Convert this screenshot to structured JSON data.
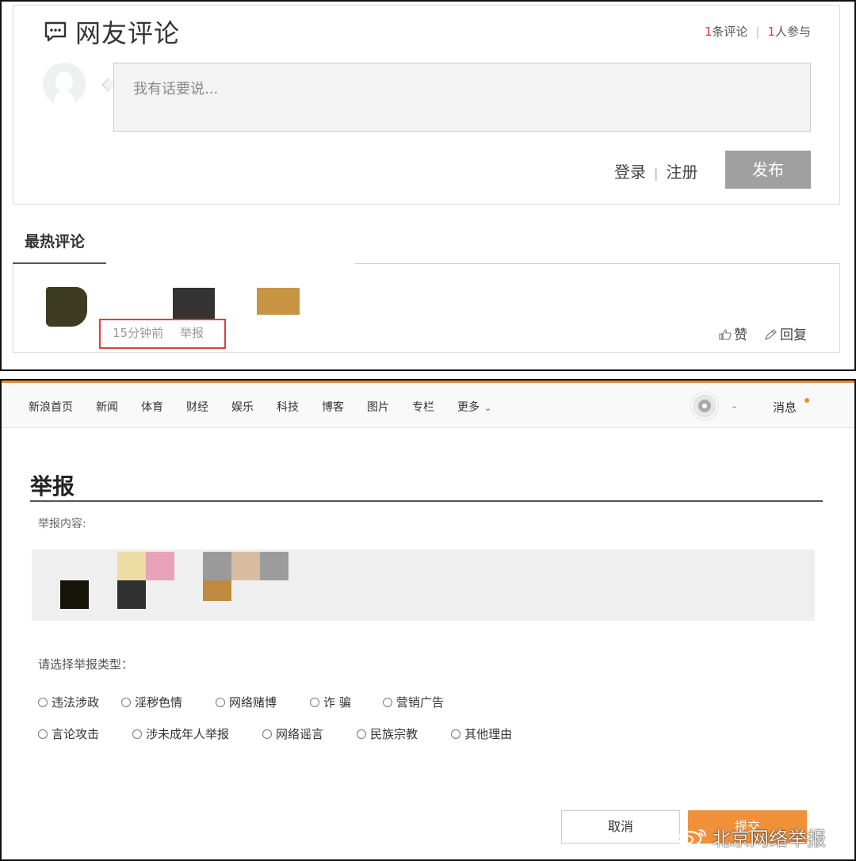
{
  "comments_panel": {
    "title": "网友评论",
    "stats": {
      "comment_count": "1",
      "comment_label": "条评论",
      "separator": "|",
      "participant_count": "1",
      "participant_label": "人参与"
    },
    "input_placeholder": "我有话要说...",
    "login_label": "登录",
    "auth_separator": "|",
    "register_label": "注册",
    "publish_label": "发布",
    "hot_comments_label": "最热评论",
    "hot_comment": {
      "time": "15分钟前",
      "report_label": "举报",
      "like_label": "赞",
      "reply_label": "回复"
    }
  },
  "report_panel": {
    "nav": [
      "新浪首页",
      "新闻",
      "体育",
      "财经",
      "娱乐",
      "科技",
      "博客",
      "图片",
      "专栏",
      "更多"
    ],
    "messages_label": "消息",
    "title": "举报",
    "content_label": "举报内容:",
    "choose_type_label": "请选择举报类型：",
    "types_row1": [
      "违法涉政",
      "淫秽色情",
      "网络赌博",
      "诈 骗",
      "营销广告"
    ],
    "types_row2": [
      "言论攻击",
      "涉未成年人举报",
      "网络谣言",
      "民族宗教",
      "其他理由"
    ],
    "cancel_label": "取消",
    "submit_label": "提交"
  },
  "watermark": "北京网络举报",
  "colors": {
    "accent_orange": "#f0913a",
    "highlight_red": "#e0403a",
    "count_red": "#e4393c",
    "publish_gray": "#a0a0a0"
  }
}
